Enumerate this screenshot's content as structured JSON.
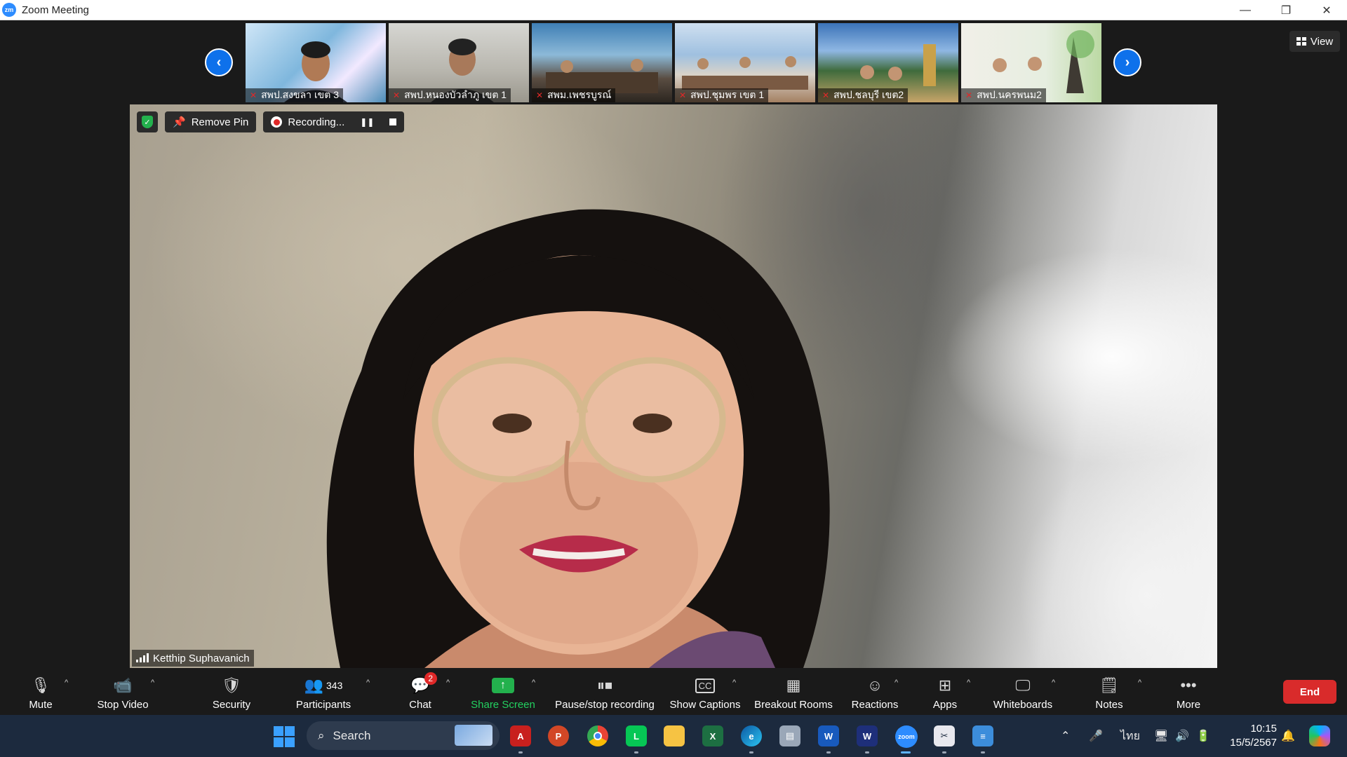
{
  "window": {
    "title": "Zoom Meeting",
    "logo_text": "zm",
    "minimize": "—",
    "restore": "❐",
    "close": "✕"
  },
  "strip": {
    "view_label": "View",
    "thumbnails": [
      {
        "name": "สพป.สงขลา เขต 3"
      },
      {
        "name": "สพป.หนองบัวลำภู เขต 1"
      },
      {
        "name": "สพม.เพชรบูรณ์"
      },
      {
        "name": "สพป.ชุมพร เขต 1"
      },
      {
        "name": "สพป.ชลบุรี เขต2"
      },
      {
        "name": "สพป.นครพนม2"
      }
    ]
  },
  "main": {
    "remove_pin": "Remove Pin",
    "recording": "Recording...",
    "speaker_name": "Ketthip Suphavanich"
  },
  "controls": {
    "mute": "Mute",
    "stop_video": "Stop Video",
    "security": "Security",
    "participants": "Participants",
    "participants_count": "343",
    "chat": "Chat",
    "chat_badge": "2",
    "share_screen": "Share Screen",
    "pause_stop_recording": "Pause/stop recording",
    "show_captions": "Show Captions",
    "captions_icon": "CC",
    "breakout_rooms": "Breakout Rooms",
    "reactions": "Reactions",
    "apps": "Apps",
    "whiteboards": "Whiteboards",
    "notes": "Notes",
    "more": "More",
    "end": "End"
  },
  "taskbar": {
    "search_placeholder": "Search",
    "language": "ไทย",
    "time": "10:15",
    "date": "15/5/2567"
  },
  "colors": {
    "accent": "#0e71eb",
    "share_green": "#23b14d",
    "end_red": "#d92b2b",
    "background": "#1a1a1a"
  }
}
